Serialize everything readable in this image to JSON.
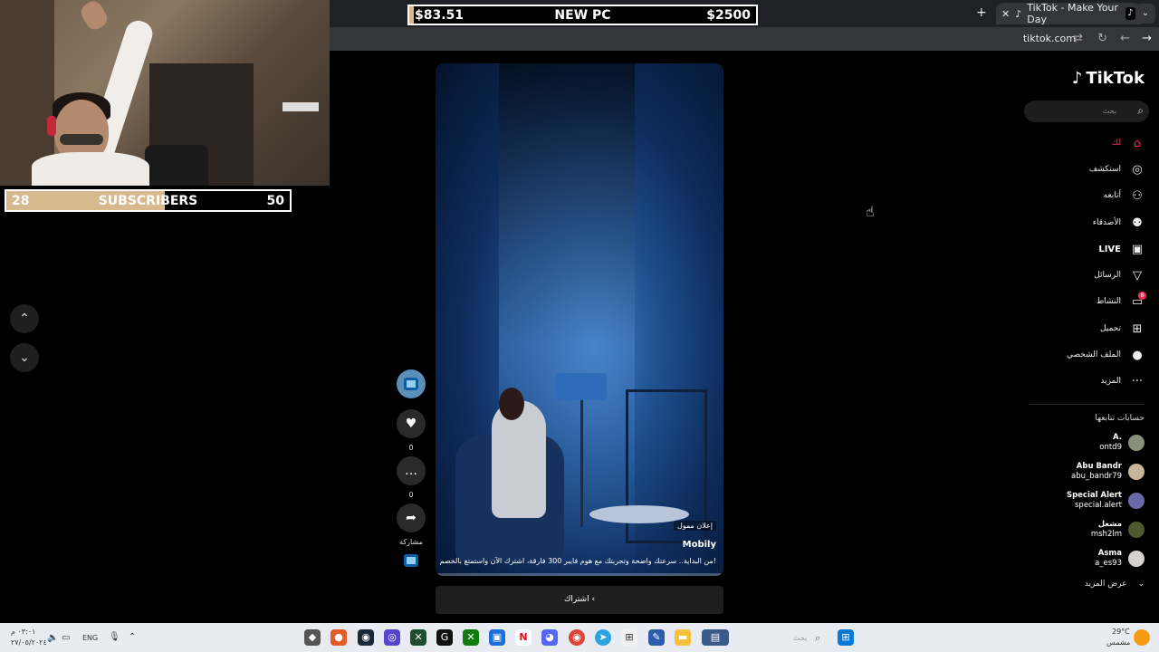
{
  "overlays": {
    "subs": {
      "current": "28",
      "label": "SUBSCRIBERS",
      "goal": "50",
      "progress": 0.56
    },
    "pc": {
      "current": "$83.51",
      "label": "NEW PC",
      "goal": "$2500",
      "progress": 0.033
    }
  },
  "browser": {
    "tab_title": "TikTok - Make Your Day",
    "url": "tiktok.com"
  },
  "tiktok": {
    "logo": "TikTok",
    "search_placeholder": "بحث",
    "nav": [
      {
        "label": "لك",
        "icon": "home-icon"
      },
      {
        "label": "استكشف",
        "icon": "compass-icon"
      },
      {
        "label": "أتابعه",
        "icon": "user-follow-icon"
      },
      {
        "label": "الأصدقاء",
        "icon": "friends-icon"
      },
      {
        "label": "LIVE",
        "icon": "live-icon"
      },
      {
        "label": "الرسائل",
        "icon": "messages-icon"
      },
      {
        "label": "النشاط",
        "icon": "activity-icon",
        "badge": "8"
      },
      {
        "label": "تحميل",
        "icon": "upload-icon"
      },
      {
        "label": "الملف الشخصي",
        "icon": "profile-icon"
      },
      {
        "label": "المزيد",
        "icon": "more-icon"
      }
    ],
    "following_title": "حسابات تتابعها",
    "accounts": [
      {
        "name": "A.",
        "handle": "ontd9"
      },
      {
        "name": "Abu Bandr",
        "handle": "abu_bandr79"
      },
      {
        "name": "Special Alert",
        "handle": "special.alert"
      },
      {
        "name": "مشعل",
        "handle": "msh2lm"
      },
      {
        "name": "Asma",
        "handle": "a_es93"
      }
    ],
    "see_more": "عرض المزيد",
    "video": {
      "sponsored": "إعلان ممول",
      "brand": "Mobily",
      "caption": "من البداية.. سرعتك واضحة وتجربتك مع هوم فايبر 300 فارقة، اشترك الآن واستمتع بالخصم!",
      "cta": "اشتراك"
    },
    "actions": {
      "likes": "0",
      "comments": "0",
      "share": "مشاركة"
    }
  },
  "taskbar": {
    "time": "٠٣:٠١ م",
    "date": "٢٧/٠٥/٢٠٢٤",
    "lang": "ENG",
    "search": "بحث",
    "weather_temp": "29°C",
    "weather_desc": "مشمس"
  }
}
